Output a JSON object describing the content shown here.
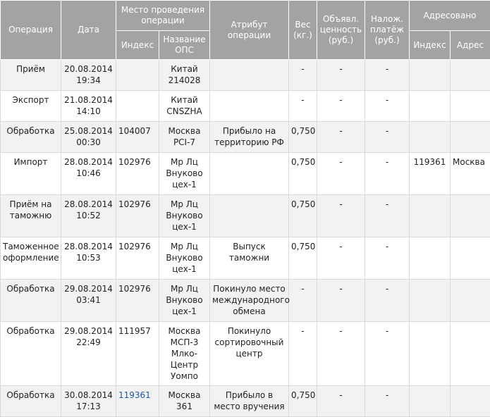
{
  "headers": {
    "operation": "Операция",
    "date": "Дата",
    "place": "Место проведения операции",
    "place_index": "Индекс",
    "place_name": "Название ОПС",
    "attribute": "Атрибут операции",
    "weight": "Вес (кг.)",
    "declared_value": "Объявл. ценность (руб.)",
    "cod": "Налож. платёж (руб.)",
    "addressed": "Адресовано",
    "addr_index": "Индекс",
    "addr_address": "Адрес"
  },
  "rows": [
    {
      "op": "Приём",
      "date": "20.08.2014 19:34",
      "index": "",
      "name": "Китай 214028",
      "attr": "",
      "weight": "-",
      "value": "-",
      "cod": "-",
      "addr_index": "",
      "addr": ""
    },
    {
      "op": "Экспорт",
      "date": "21.08.2014 14:10",
      "index": "",
      "name": "Китай CNSZHA",
      "attr": "",
      "weight": "-",
      "value": "-",
      "cod": "-",
      "addr_index": "",
      "addr": ""
    },
    {
      "op": "Обработка",
      "date": "25.08.2014 00:30",
      "index": "104007",
      "name": "Москва PCI-7",
      "attr": "Прибыло на территорию РФ",
      "weight": "0,750",
      "value": "-",
      "cod": "-",
      "addr_index": "",
      "addr": ""
    },
    {
      "op": "Импорт",
      "date": "28.08.2014 10:46",
      "index": "102976",
      "name": "Мр Лц Внуково цех-1",
      "attr": "",
      "weight": "0,750",
      "value": "-",
      "cod": "-",
      "addr_index": "119361",
      "addr": "Москва"
    },
    {
      "op": "Приём на таможню",
      "date": "28.08.2014 10:52",
      "index": "102976",
      "name": "Мр Лц Внуково цех-1",
      "attr": "",
      "weight": "0,750",
      "value": "-",
      "cod": "-",
      "addr_index": "",
      "addr": ""
    },
    {
      "op": "Таможенное оформление",
      "date": "28.08.2014 10:53",
      "index": "102976",
      "name": "Мр Лц Внуково цех-1",
      "attr": "Выпуск таможни",
      "weight": "0,750",
      "value": "-",
      "cod": "-",
      "addr_index": "",
      "addr": ""
    },
    {
      "op": "Обработка",
      "date": "29.08.2014 03:41",
      "index": "102976",
      "name": "Мр Лц Внуково цех-1",
      "attr": "Покинуло место международного обмена",
      "weight": "-",
      "value": "-",
      "cod": "-",
      "addr_index": "",
      "addr": ""
    },
    {
      "op": "Обработка",
      "date": "29.08.2014 22:49",
      "index": "111957",
      "name": "Москва МСП-3 Млко-Центр Уомпо",
      "attr": "Покинуло сортировочный центр",
      "weight": "-",
      "value": "-",
      "cod": "-",
      "addr_index": "",
      "addr": ""
    },
    {
      "op": "Обработка",
      "date": "30.08.2014 17:13",
      "index": "119361",
      "index_link": true,
      "name": "Москва 361",
      "attr": "Прибыло в место вручения",
      "weight": "0,750",
      "value": "-",
      "cod": "-",
      "addr_index": "",
      "addr": ""
    }
  ]
}
